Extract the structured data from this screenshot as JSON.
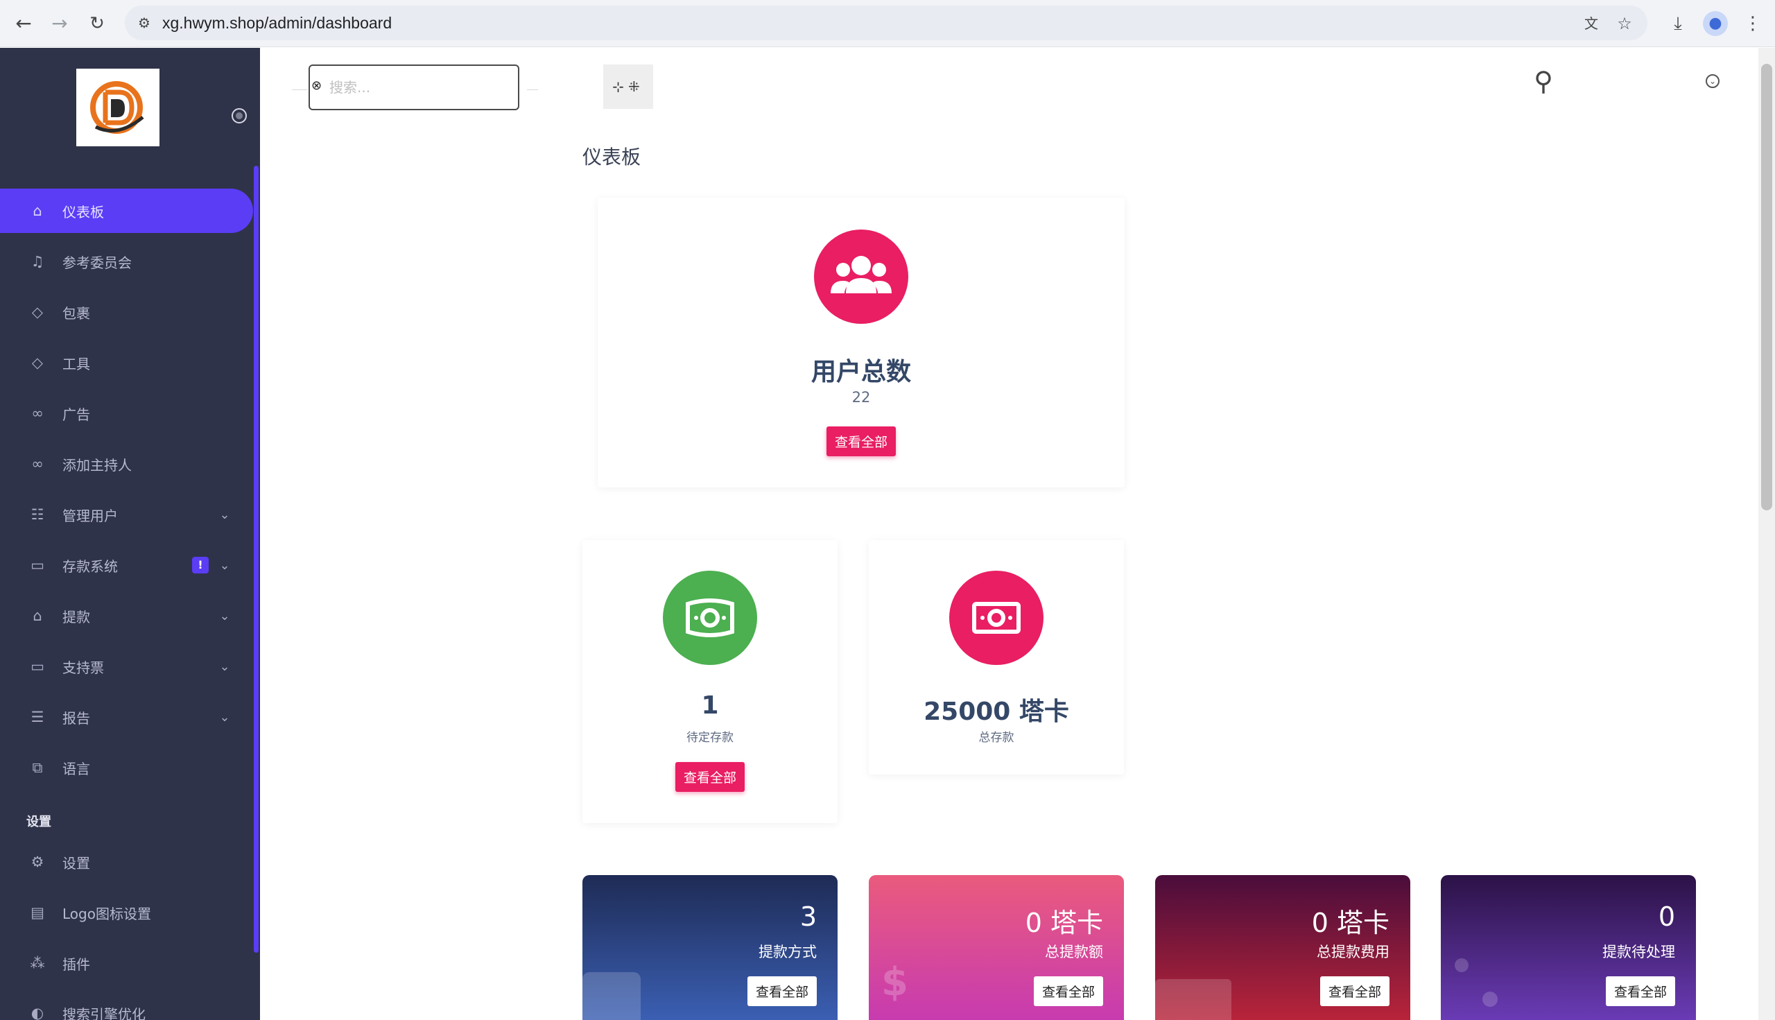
{
  "browser": {
    "url": "xg.hwym.shop/admin/dashboard"
  },
  "sidebar": {
    "items": [
      {
        "label": "仪表板",
        "icon": "home-icon",
        "active": true
      },
      {
        "label": "参考委员会",
        "icon": "bell-icon"
      },
      {
        "label": "包裹",
        "icon": "tag-icon"
      },
      {
        "label": "工具",
        "icon": "tag-icon"
      },
      {
        "label": "广告",
        "icon": "link-icon"
      },
      {
        "label": "添加主持人",
        "icon": "link-icon"
      },
      {
        "label": "管理用户",
        "icon": "users-icon",
        "submenu": true
      },
      {
        "label": "存款系统",
        "icon": "card-icon",
        "submenu": true,
        "badge": "!"
      },
      {
        "label": "提款",
        "icon": "bank-icon",
        "submenu": true
      },
      {
        "label": "支持票",
        "icon": "ticket-icon",
        "submenu": true
      },
      {
        "label": "报告",
        "icon": "list-icon",
        "submenu": true
      }
    ],
    "language": {
      "label": "语言",
      "icon": "language-icon"
    },
    "settings_section": "设置",
    "settings_items": [
      {
        "label": "设置",
        "icon": "gear-icon"
      },
      {
        "label": "Logo图标设置",
        "icon": "image-icon"
      },
      {
        "label": "插件",
        "icon": "plugin-icon"
      },
      {
        "label": "搜索引擎优化",
        "icon": "globe-icon"
      }
    ]
  },
  "topbar": {
    "search_placeholder": "搜索..."
  },
  "main": {
    "page_title": "仪表板",
    "total_users": {
      "title": "用户总数",
      "value": "22",
      "button": "查看全部"
    },
    "pending_deposits": {
      "value": "1",
      "label": "待定存款",
      "button": "查看全部"
    },
    "total_deposits": {
      "value": "25000 塔卡",
      "label": "总存款"
    },
    "stats": [
      {
        "value": "3",
        "label": "提款方式",
        "button": "查看全部"
      },
      {
        "value": "0 塔卡",
        "label": "总提款额",
        "button": "查看全部"
      },
      {
        "value": "0 塔卡",
        "label": "总提款费用",
        "button": "查看全部"
      },
      {
        "value": "0",
        "label": "提款待处理",
        "button": "查看全部"
      }
    ]
  },
  "colors": {
    "sidebar_bg": "#2f3349",
    "accent": "#5a3df5",
    "pink": "#e91e63",
    "green": "#4caf50"
  }
}
